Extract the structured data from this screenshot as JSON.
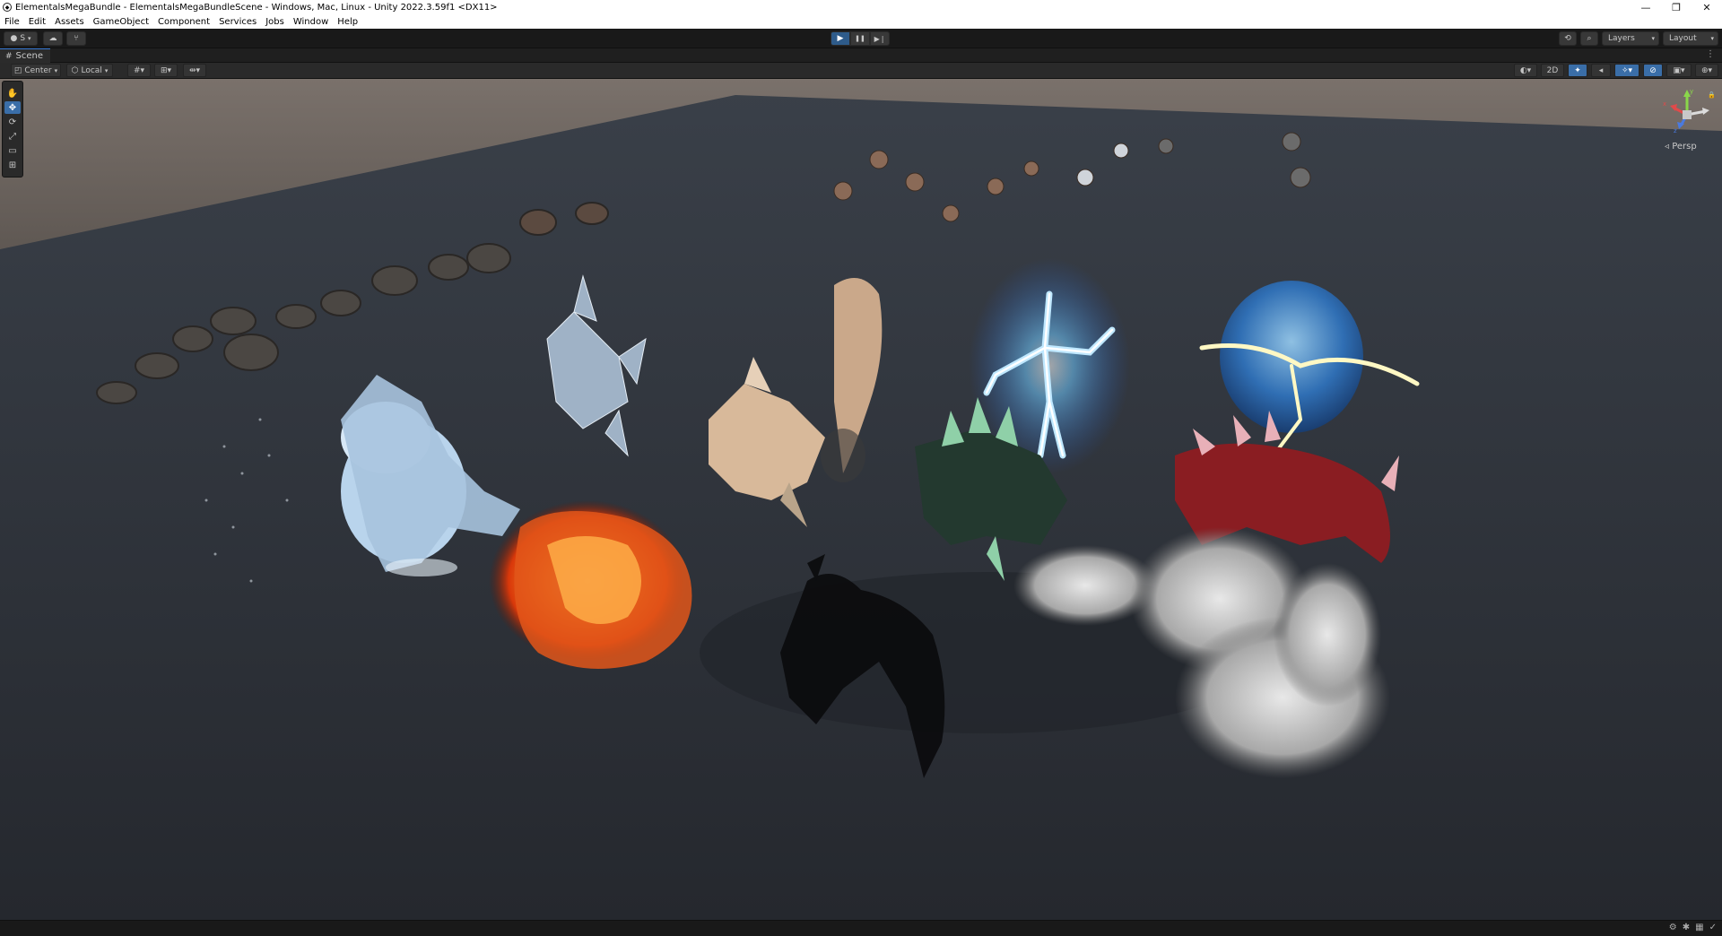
{
  "window": {
    "title": "ElementalsMegaBundle - ElementalsMegaBundleScene - Windows, Mac, Linux - Unity 2022.3.59f1 <DX11>",
    "controls": [
      "—",
      "❐",
      "✕"
    ]
  },
  "menu": {
    "items": [
      "File",
      "Edit",
      "Assets",
      "GameObject",
      "Component",
      "Services",
      "Jobs",
      "Window",
      "Help"
    ]
  },
  "toolbar": {
    "account_label": "S",
    "layers_label": "Layers",
    "layout_label": "Layout",
    "play_icons": {
      "play": "▶",
      "pause": "❚❚",
      "step": "▶❘"
    }
  },
  "scene_tab": {
    "label": "Scene"
  },
  "scene_toolbar": {
    "pivot_label": "Center",
    "space_label": "Local",
    "mode_2d_label": "2D"
  },
  "viewport": {
    "projection_label": "Persp",
    "gizmo_axes": {
      "y": "y",
      "x": "x",
      "z": "z"
    },
    "colors": {
      "sky": "#6f6660",
      "floor": "#2c3038"
    }
  }
}
